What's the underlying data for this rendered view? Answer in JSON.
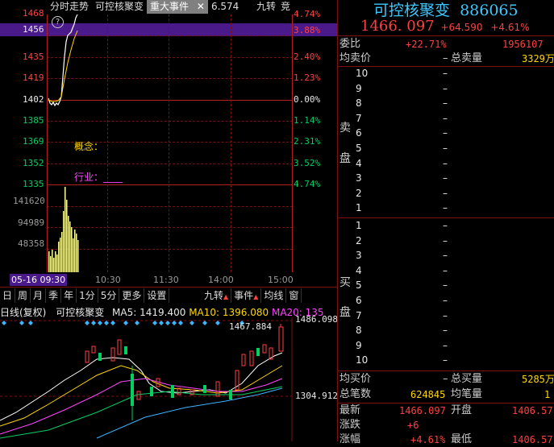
{
  "header_tabs": [
    {
      "label": "分时走势"
    },
    {
      "label": "可控核聚变"
    },
    {
      "label": "重大事件",
      "active": true
    },
    {
      "label": "6.574"
    },
    {
      "label": "九转"
    },
    {
      "label": "竞"
    }
  ],
  "price_axis": [
    "1468",
    "1456",
    "1435",
    "1419",
    "1402",
    "1385",
    "1369",
    "1352",
    "1335"
  ],
  "percent_axis": [
    "4.74%",
    "3.88%",
    "2.40%",
    "1.23%",
    "0.00%",
    "1.14%",
    "2.31%",
    "3.52%",
    "4.74%"
  ],
  "volume_axis": [
    "141620",
    "94989",
    "48358"
  ],
  "time_axis": [
    "05-16 09:30",
    "10:30",
    "11:30",
    "14:00",
    "15:00"
  ],
  "concept_label": "概念：",
  "industry_label": "行业：____",
  "kline_toolbar": [
    "日",
    "周",
    "月",
    "季",
    "年",
    "1分",
    "5分",
    "更多",
    "设置"
  ],
  "kline_toolbar_right": [
    "九转",
    "事件",
    "均线",
    "窗"
  ],
  "kline_info": {
    "period": "日线(复权)",
    "name": "可控核聚变",
    "ma5": "MA5: 1419.400",
    "ma10": "MA10: 1396.080",
    "ma20": "MA20: 135"
  },
  "kline_axis": {
    "top": "1486.098",
    "bottom": "1304.912",
    "peak": "1467.884"
  },
  "quote": {
    "name": "可控核聚变",
    "code": "886065",
    "price": "1466. 097",
    "change": "+64.590",
    "change_pct": "+4.61%"
  },
  "weibi": {
    "label": "委比",
    "value": "+22.71%",
    "diff": "1956107"
  },
  "sell_header": {
    "left": "均卖价",
    "dash": "–",
    "right": "总卖量",
    "value": "3329万"
  },
  "sell_side_label": [
    "卖",
    "盘"
  ],
  "sell_levels": [
    "10",
    "9",
    "8",
    "7",
    "6",
    "5",
    "4",
    "3",
    "2",
    "1"
  ],
  "buy_side_label": [
    "买",
    "盘"
  ],
  "buy_levels": [
    "1",
    "2",
    "3",
    "4",
    "5",
    "6",
    "7",
    "8",
    "9",
    "10"
  ],
  "level_placeholder": "–",
  "buy_footer": {
    "left": "均买价",
    "dash": "–",
    "right": "总买量",
    "value": "5285万"
  },
  "stats": [
    {
      "k1": "总笔数",
      "v1": "624845",
      "k2": "均笔量",
      "v2": "1"
    },
    {
      "k1": "最新",
      "v1": "1466.097",
      "k2": "开盘",
      "v2": "1406.57"
    },
    {
      "k1": "涨跌",
      "v1": "+6",
      "k2": "",
      "v2": ""
    },
    {
      "k1": "涨幅",
      "v1": "+4.61%",
      "k2": "最低",
      "v2": "1406.57"
    }
  ],
  "colors": {
    "up": "#ff4040",
    "down": "#00d060",
    "grid": "#7a1010",
    "accent": "#ffd700"
  }
}
